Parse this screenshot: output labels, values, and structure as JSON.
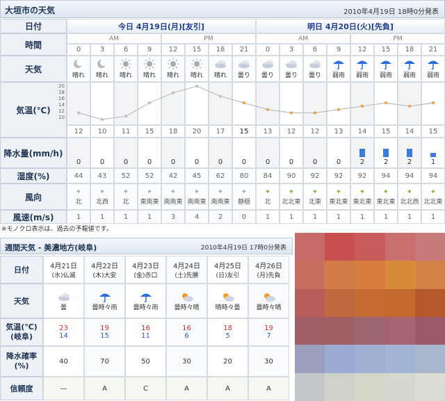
{
  "header": {
    "title": "大垣市の天気",
    "issued": "2010年4月19日 18時0分発表"
  },
  "days": {
    "label": "日付",
    "today": "今日  4月19日(月)[友引]",
    "tomorrow": "明日  4月20日(火)[先負]"
  },
  "time": {
    "label": "時間",
    "am": "AM",
    "pm": "PM",
    "hours": [
      "0",
      "3",
      "6",
      "9",
      "12",
      "15",
      "18",
      "21",
      "0",
      "3",
      "6",
      "9",
      "12",
      "15",
      "18",
      "21"
    ]
  },
  "weather": {
    "label": "天気",
    "items": [
      {
        "icon": "moon-icon",
        "text": "晴れ"
      },
      {
        "icon": "moon-icon",
        "text": "晴れ"
      },
      {
        "icon": "sun-icon",
        "text": "晴れ"
      },
      {
        "icon": "sun-icon",
        "text": "晴れ"
      },
      {
        "icon": "sun-icon",
        "text": "晴れ"
      },
      {
        "icon": "sun-icon",
        "text": "晴れ"
      },
      {
        "icon": "cloud-icon",
        "text": "晴れ"
      },
      {
        "icon": "cloud-icon",
        "text": "曇り"
      },
      {
        "icon": "cloud-icon",
        "text": "曇り"
      },
      {
        "icon": "cloud-icon",
        "text": "曇り"
      },
      {
        "icon": "cloud-icon",
        "text": "曇り"
      },
      {
        "icon": "umbrella-icon",
        "text": "弱雨"
      },
      {
        "icon": "umbrella-icon",
        "text": "弱雨"
      },
      {
        "icon": "umbrella-icon",
        "text": "弱雨"
      },
      {
        "icon": "umbrella-icon",
        "text": "弱雨"
      },
      {
        "icon": "umbrella-icon",
        "text": "弱雨"
      }
    ]
  },
  "temperature": {
    "label": "気温(℃)",
    "axis": [
      "20",
      "18",
      "16",
      "14",
      "12",
      "10"
    ],
    "values": [
      "12",
      "10",
      "11",
      "15",
      "18",
      "20",
      "17",
      "15",
      "13",
      "12",
      "12",
      "13",
      "14",
      "15",
      "14",
      "15"
    ]
  },
  "precip": {
    "label": "降水量(mm/h)",
    "values": [
      "0",
      "0",
      "0",
      "0",
      "0",
      "0",
      "0",
      "0",
      "0",
      "0",
      "0",
      "0",
      "2",
      "2",
      "2",
      "1"
    ]
  },
  "humidity": {
    "label": "湿度(%)",
    "values": [
      "44",
      "43",
      "52",
      "52",
      "42",
      "45",
      "62",
      "80",
      "84",
      "90",
      "92",
      "92",
      "92",
      "94",
      "94",
      "94"
    ]
  },
  "wind_dir": {
    "label": "風向",
    "values": [
      "北",
      "北西",
      "北",
      "東南東",
      "南南東",
      "南南東",
      "南南東",
      "静穏",
      "北",
      "北北東",
      "北東",
      "東北東",
      "東北東",
      "東北東",
      "北北西",
      "北北東"
    ]
  },
  "wind_speed": {
    "label": "風速(m/s)",
    "values": [
      "1",
      "1",
      "1",
      "1",
      "3",
      "4",
      "2",
      "0",
      "1",
      "1",
      "1",
      "1",
      "1",
      "1",
      "1",
      "1"
    ]
  },
  "note": "※モノクロ表示は、過去の予報値です。",
  "weekly": {
    "title": "週間天気 - 美濃地方(岐阜)",
    "issued": "2010年4月19日 17時0分発表",
    "date_label": "日付",
    "weather_label": "天気",
    "temp_label": "気温(℃)\n(岐阜)",
    "precip_label": "降水確率\n(%)",
    "rel_label": "信頼度",
    "days": [
      {
        "date": "4月21日",
        "dow": "(水)仏滅",
        "weather": "曇",
        "hi": "23",
        "lo": "14",
        "precip": "40",
        "rel": "—",
        "icon": "cloud-icon"
      },
      {
        "date": "4月22日",
        "dow": "(木)大安",
        "weather": "曇時々雨",
        "hi": "19",
        "lo": "15",
        "precip": "70",
        "rel": "A",
        "icon": "umbrella-icon"
      },
      {
        "date": "4月23日",
        "dow": "(金)赤口",
        "weather": "曇時々雨",
        "hi": "16",
        "lo": "11",
        "precip": "50",
        "rel": "C",
        "icon": "umbrella-icon"
      },
      {
        "date": "4月24日",
        "dow": "(土)先勝",
        "weather": "曇時々晴",
        "hi": "16",
        "lo": "6",
        "precip": "30",
        "rel": "A",
        "icon": "sun-cloud-icon"
      },
      {
        "date": "4月25日",
        "dow": "(日)友引",
        "weather": "晴時々曇",
        "hi": "18",
        "lo": "5",
        "precip": "20",
        "rel": "A",
        "icon": "sun-cloud-icon"
      },
      {
        "date": "4月26日",
        "dow": "(月)先負",
        "weather": "曇時々晴",
        "hi": "19",
        "lo": "7",
        "precip": "30",
        "rel": "A",
        "icon": "sun-cloud-icon"
      }
    ]
  },
  "colors": {
    "rain": "#3e7be0",
    "temp_line": "#bdbdbd",
    "temp_dot_orange": "#f29a3a"
  }
}
